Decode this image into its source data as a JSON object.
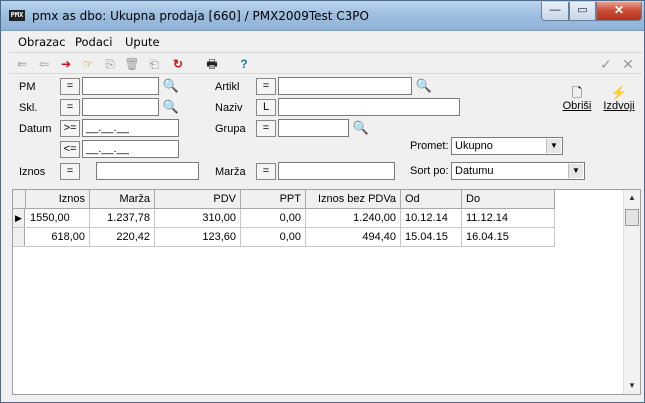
{
  "window": {
    "icon_text": "PMX",
    "title": "pmx as dbo: Ukupna prodaja [660] / PMX2009Test C3PO",
    "min_glyph": "—",
    "max_glyph": "▭",
    "close_glyph": "✕"
  },
  "menu": [
    "Obrazac",
    "Podaci",
    "Upute"
  ],
  "toolbar": {
    "icons": [
      "⇐",
      "⇦",
      "➔",
      "☞",
      "⎘",
      "🗑",
      "⎗",
      "↻",
      "🖶",
      "?",
      "✓",
      "✕"
    ]
  },
  "form": {
    "pm_label": "PM",
    "pm_op": "=",
    "skl_label": "Skl.",
    "skl_op": "=",
    "datum_label": "Datum",
    "datum_op1": ">=",
    "datum_op2": "<=",
    "datum_from": "__.__.__",
    "datum_to": "__.__.__",
    "iznos_label": "Iznos",
    "iznos_op": "=",
    "artikl_label": "Artikl",
    "artikl_op": "=",
    "naziv_label": "Naziv",
    "naziv_op": "L",
    "grupa_label": "Grupa",
    "grupa_op": "=",
    "marza_label": "Marža",
    "marza_op": "=",
    "promet_label": "Promet:",
    "promet_value": "Ukupno",
    "sort_label": "Sort po:",
    "sort_value": "Datumu",
    "obrisi": "Obriši",
    "izdvoji": "Izdvoji"
  },
  "grid": {
    "columns": [
      "Iznos",
      "Marža",
      "PDV",
      "PPT",
      "Iznos bez PDVa",
      "Od",
      "Do"
    ],
    "rows": [
      [
        "1550,00",
        "1.237,78",
        "310,00",
        "0,00",
        "1.240,00",
        "10.12.14",
        "11.12.14"
      ],
      [
        "618,00",
        "220,42",
        "123,60",
        "0,00",
        "494,40",
        "15.04.15",
        "16.04.15"
      ]
    ],
    "current_row_marker": "▶"
  },
  "colors": {
    "titlebar": "#9fbfe0",
    "close": "#c94a33",
    "dead_toolbar_icon": "#999999",
    "red_arrow": "#cc1010"
  }
}
